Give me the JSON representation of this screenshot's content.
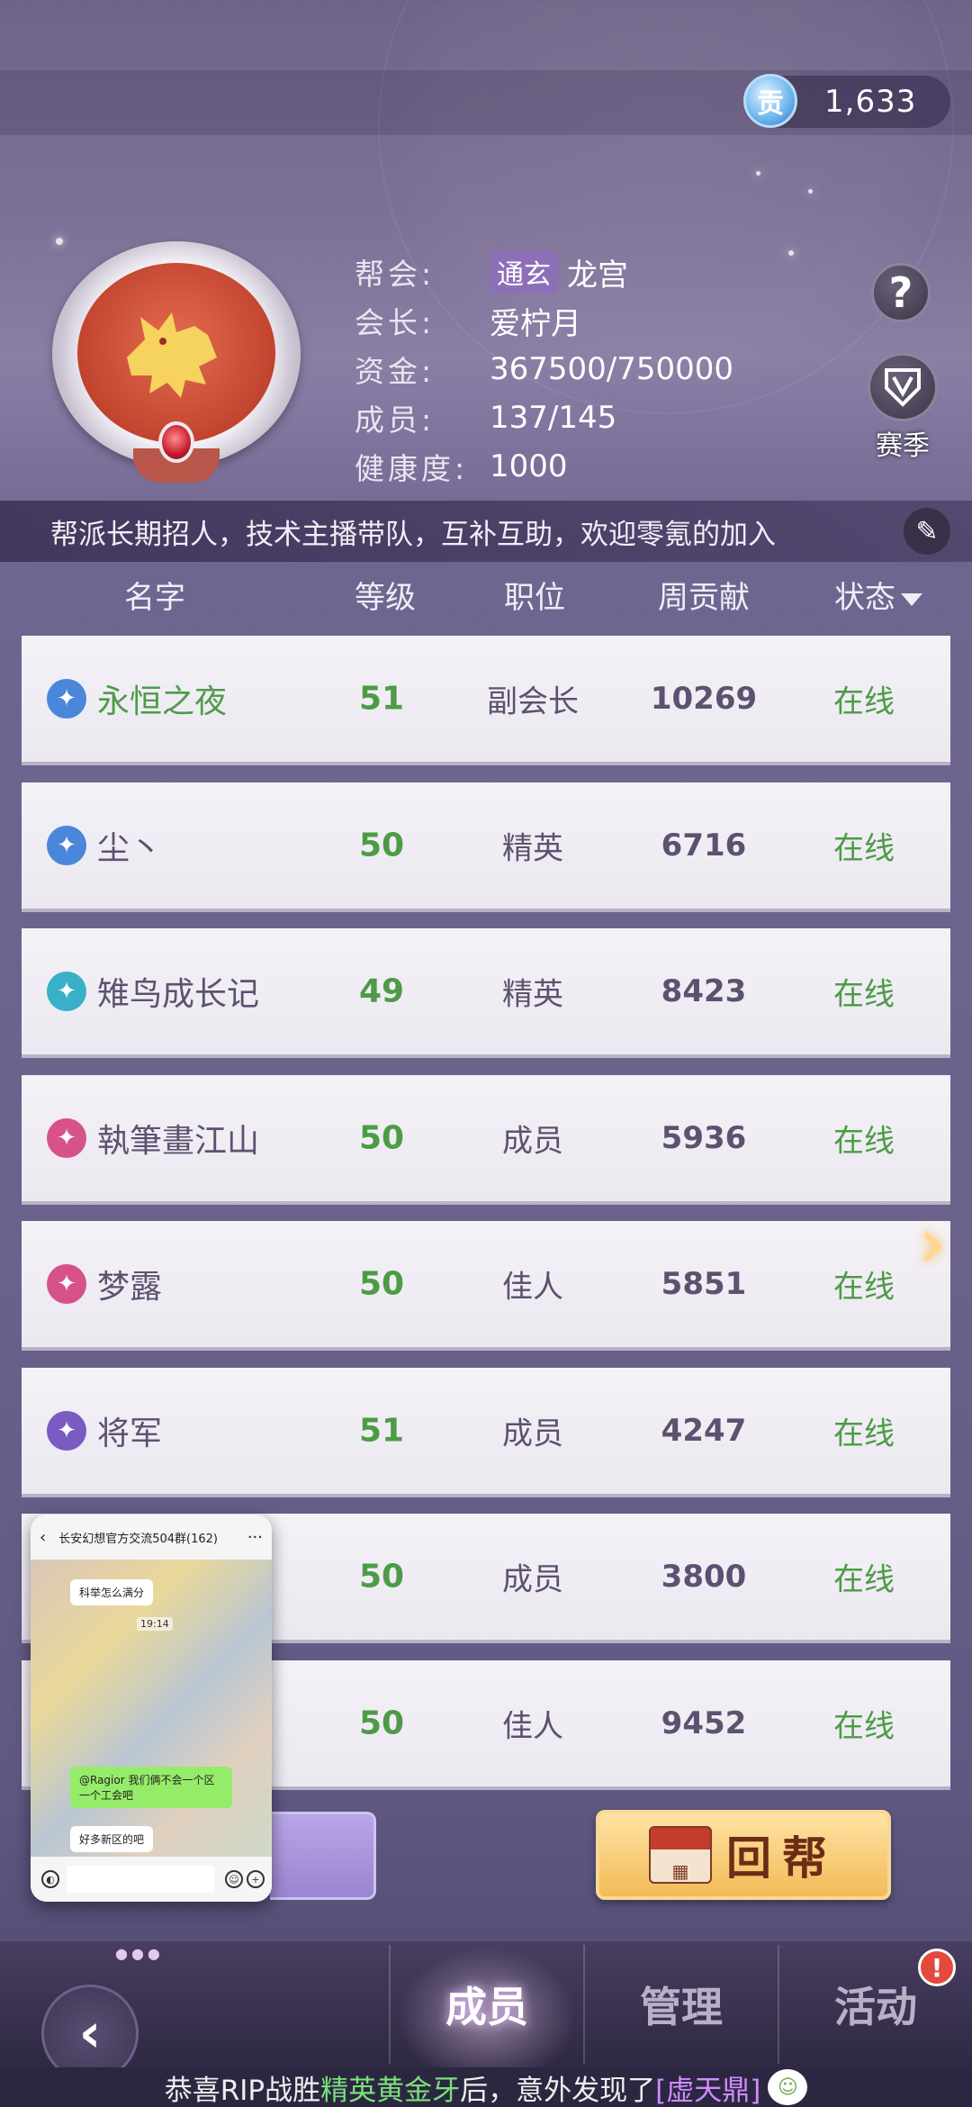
{
  "currency": {
    "icon": "贡",
    "value": "1,633"
  },
  "guild": {
    "labels": {
      "guild": "帮会:",
      "leader": "会长:",
      "funds": "资金:",
      "members": "成员:",
      "health": "健康度:"
    },
    "tag": "通玄",
    "name": "龙宫",
    "leader": "爱柠月",
    "funds": "367500/750000",
    "members": "137/145",
    "health": "1000"
  },
  "buttons": {
    "help": "?",
    "season": "赛季",
    "return": "回帮"
  },
  "announcement": "帮派长期招人，技术主播带队，互补互助，欢迎零氪的加入",
  "table": {
    "headers": {
      "name": "名字",
      "level": "等级",
      "role": "职位",
      "contribution": "周贡献",
      "status": "状态"
    },
    "rows": [
      {
        "name": "永恒之夜",
        "level": "51",
        "role": "副会长",
        "contribution": "10269",
        "status": "在线",
        "icon_color": "#4a86d9",
        "name_green": true
      },
      {
        "name": "尘丶",
        "level": "50",
        "role": "精英",
        "contribution": "6716",
        "status": "在线",
        "icon_color": "#4a86d9",
        "name_green": false
      },
      {
        "name": "雉鸟成长记",
        "level": "49",
        "role": "精英",
        "contribution": "8423",
        "status": "在线",
        "icon_color": "#3ab0c8",
        "name_green": false
      },
      {
        "name": "執筆畫江山",
        "level": "50",
        "role": "成员",
        "contribution": "5936",
        "status": "在线",
        "icon_color": "#d7528a",
        "name_green": false
      },
      {
        "name": "梦露",
        "level": "50",
        "role": "佳人",
        "contribution": "5851",
        "status": "在线",
        "icon_color": "#d7528a",
        "name_green": false
      },
      {
        "name": "将军",
        "level": "51",
        "role": "成员",
        "contribution": "4247",
        "status": "在线",
        "icon_color": "#7a5bc2",
        "name_green": false
      },
      {
        "name": "",
        "level": "50",
        "role": "成员",
        "contribution": "3800",
        "status": "在线",
        "icon_color": "",
        "name_green": false
      },
      {
        "name": "",
        "level": "50",
        "role": "佳人",
        "contribution": "9452",
        "status": "在线",
        "icon_color": "",
        "name_green": false
      }
    ]
  },
  "float_window": {
    "title": "长安幻想官方交流504群(162)",
    "time": "19:14",
    "messages": [
      "科举怎么满分",
      "@Ragior 我们俩不会一个区 一个工会吧",
      "好多新区的吧"
    ]
  },
  "nav": {
    "tabs": [
      "成员",
      "管理",
      "活动"
    ],
    "active": "成员",
    "alert": "!"
  },
  "ticker": {
    "prefix": "恭喜RIP战胜",
    "boss": "精英黄金牙",
    "middle": "后，意外发现了",
    "item": "[虚天鼎]"
  }
}
